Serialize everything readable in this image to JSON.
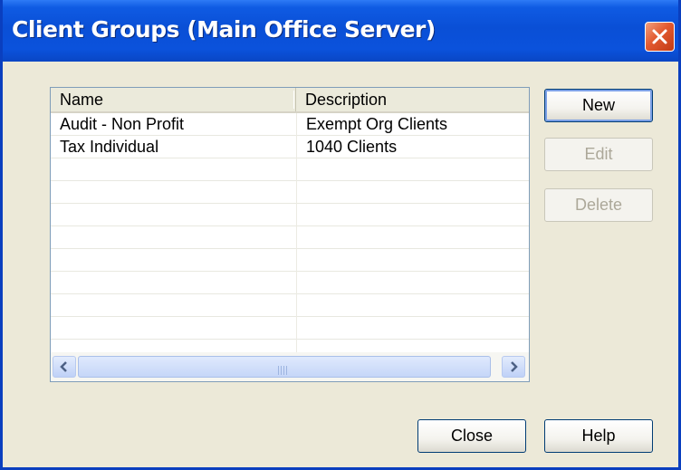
{
  "window": {
    "title": "Client Groups (Main Office Server)"
  },
  "list": {
    "columns": {
      "name": "Name",
      "description": "Description"
    },
    "rows": [
      {
        "name": "Audit - Non Profit",
        "description": "Exempt Org Clients"
      },
      {
        "name": "Tax Individual",
        "description": "1040 Clients"
      },
      {
        "name": "",
        "description": ""
      },
      {
        "name": "",
        "description": ""
      },
      {
        "name": "",
        "description": ""
      },
      {
        "name": "",
        "description": ""
      },
      {
        "name": "",
        "description": ""
      },
      {
        "name": "",
        "description": ""
      },
      {
        "name": "",
        "description": ""
      },
      {
        "name": "",
        "description": ""
      }
    ]
  },
  "buttons": {
    "new": "New",
    "edit": "Edit",
    "delete": "Delete",
    "close": "Close",
    "help": "Help"
  }
}
